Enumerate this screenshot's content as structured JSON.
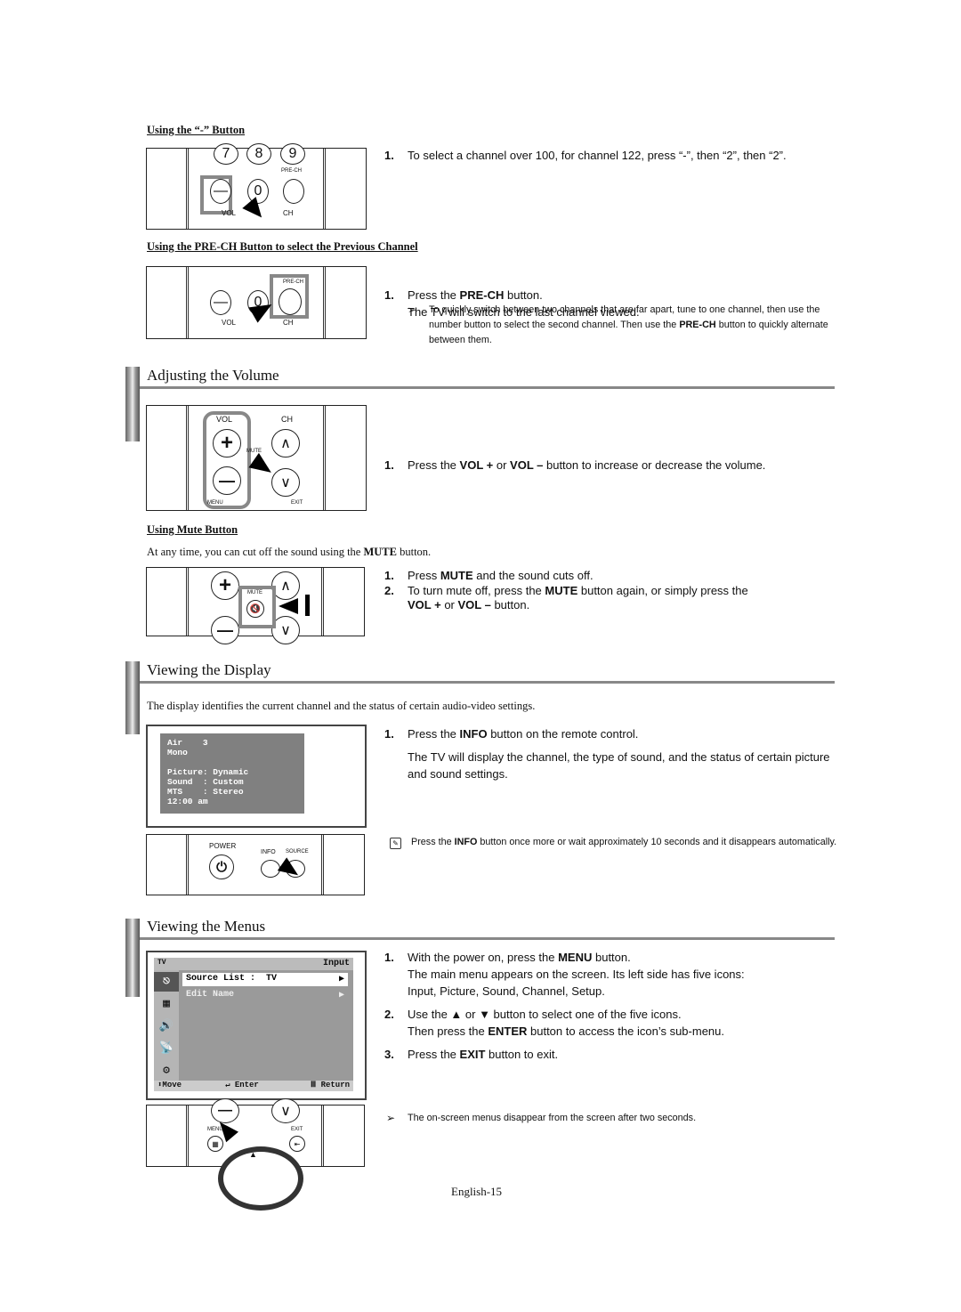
{
  "dash_section": {
    "heading": "Using the “-” Button",
    "remote_labels": {
      "k7": "7",
      "k8": "8",
      "k9": "9",
      "k0": "0",
      "minus": "—",
      "prech": "PRE-CH",
      "vol": "VOL",
      "ch": "CH"
    },
    "step1_num": "1.",
    "step1_text": "To select a channel over 100, for channel 122, press “-”, then “2”, then “2”."
  },
  "prech_section": {
    "heading": "Using the PRE-CH Button to select the Previous Channel",
    "remote_labels": {
      "k0": "0",
      "minus": "—",
      "prech": "PRE-CH",
      "vol": "VOL",
      "ch": "CH"
    },
    "step1_num": "1.",
    "step1_pre": "Press the ",
    "step1_bold": "PRE-CH",
    "step1_post": " button.",
    "step1_line2": "The TV will switch to the last channel viewed.",
    "note_bullet": "➢",
    "note_pre": "To quickly switch between two channels that are far apart, tune to one channel, then use the number button to select the second channel. Then use the ",
    "note_bold": "PRE-CH",
    "note_post": " button to quickly alternate between them."
  },
  "volume_section": {
    "title": "Adjusting the Volume",
    "remote_labels": {
      "vol": "VOL",
      "ch": "CH",
      "plus": "+",
      "minus": "—",
      "mute": "MUTE",
      "menu": "MENU",
      "exit": "EXIT",
      "up": "∧",
      "down": "∨"
    },
    "step1_num": "1.",
    "step1_a": "Press the ",
    "step1_b": "VOL +",
    "step1_c": " or ",
    "step1_d": "VOL –",
    "step1_e": " button to increase or decrease the volume."
  },
  "mute_section": {
    "heading": "Using Mute Button",
    "intro_pre": "At any time, you can cut off the sound using the ",
    "intro_bold": "MUTE",
    "intro_post": " button.",
    "remote_labels": {
      "plus": "+",
      "minus": "—",
      "mute": "MUTE",
      "up": "∧",
      "down": "∨",
      "mute_icon": "🔇"
    },
    "step1_num": "1.",
    "step1_a": "Press ",
    "step1_b": "MUTE",
    "step1_c": " and the sound cuts off.",
    "step2_num": "2.",
    "step2_a": "To turn mute off, press the ",
    "step2_b": "MUTE",
    "step2_c": " button again, or simply press the ",
    "step2_d": "VOL +",
    "step2_e": " or ",
    "step2_f": "VOL –",
    "step2_g": " button."
  },
  "display_section": {
    "title": "Viewing the Display",
    "intro": "The display identifies the current channel and the status of certain audio-video settings.",
    "osd_lines": [
      "Air    3",
      "Mono",
      "",
      "Picture: Dynamic",
      "Sound  : Custom",
      "MTS    : Stereo",
      "12:00 am"
    ],
    "remote_labels": {
      "power": "POWER",
      "info": "INFO",
      "source": "SOURCE",
      "power_icon": "⏻"
    },
    "step1_num": "1.",
    "step1_a": "Press the ",
    "step1_b": "INFO",
    "step1_c": " button on the remote control.",
    "step1_line2": "The TV will display the channel, the type of sound, and the status of certain picture and sound settings.",
    "note_pre": "Press the ",
    "note_bold": "INFO",
    "note_post": " button once more or wait approximately 10 seconds and it disappears automatically."
  },
  "menus_section": {
    "title": "Viewing the Menus",
    "menu": {
      "header_left": "TV",
      "header_right": "Input",
      "items": [
        {
          "label": "Source List :  TV",
          "arrow": "▶",
          "selected": true
        },
        {
          "label": "Edit Name",
          "arrow": "▶",
          "selected": false
        }
      ],
      "side_icons": [
        "input-icon",
        "picture-icon",
        "sound-icon",
        "channel-icon",
        "setup-icon"
      ],
      "footer": {
        "move": "Move",
        "enter": "Enter",
        "return": "Return",
        "move_icon": "⬍",
        "enter_icon": "↵",
        "return_icon": "Ⅲ"
      }
    },
    "remote_labels": {
      "menu": "MENU",
      "exit": "EXIT",
      "minus": "—",
      "down": "∨",
      "up": "▲"
    },
    "step1_num": "1.",
    "step1_a": "With the power on, press the ",
    "step1_b": "MENU",
    "step1_c": " button.",
    "step1_line2": "The main menu appears on the screen. Its left side has five icons:",
    "step1_line3": "Input, Picture, Sound, Channel, Setup.",
    "step2_num": "2.",
    "step2_a": "Use the ▲ or ▼ button to select one of the five icons.",
    "step2_line2_a": "Then press the ",
    "step2_line2_b": "ENTER",
    "step2_line2_c": " button to access the icon’s sub-menu.",
    "step3_num": "3.",
    "step3_a": "Press the ",
    "step3_b": "EXIT",
    "step3_c": " button to exit.",
    "note_bullet": "➢",
    "note": "The on-screen menus disappear from the screen after two seconds."
  },
  "footer": {
    "page_label": "English-15"
  }
}
